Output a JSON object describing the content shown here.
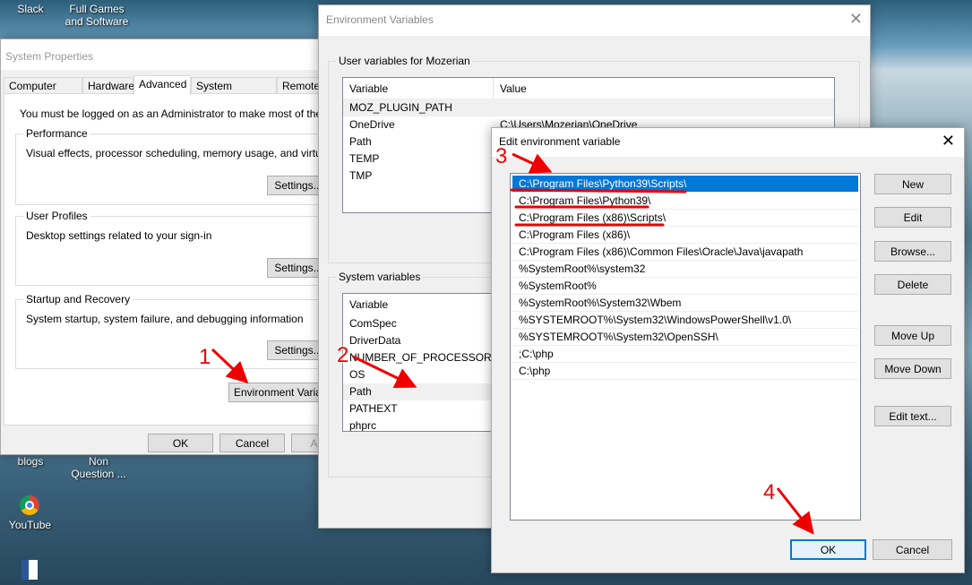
{
  "desktop": {
    "icons": [
      "Slack",
      "Full Games\nand Software",
      "blogs",
      "Non\nQuestion ...",
      "YouTube"
    ]
  },
  "sysprops": {
    "title": "System Properties",
    "tabs": [
      "Computer Name",
      "Hardware",
      "Advanced",
      "System Protection",
      "Remote"
    ],
    "active_tab": "Advanced",
    "admin_note": "You must be logged on as an Administrator to make most of these chan",
    "performance": {
      "label": "Performance",
      "desc": "Visual effects, processor scheduling, memory usage, and virtual memo",
      "button": "Settings..."
    },
    "profiles": {
      "label": "User Profiles",
      "desc": "Desktop settings related to your sign-in",
      "button": "Settings..."
    },
    "startup": {
      "label": "Startup and Recovery",
      "desc": "System startup, system failure, and debugging information",
      "button": "Settings..."
    },
    "env_button": "Environment Variables...",
    "ok": "OK",
    "cancel": "Cancel",
    "apply": "Apply"
  },
  "envvars": {
    "title": "Environment Variables",
    "user_group": "User variables for Mozerian",
    "col_variable": "Variable",
    "col_value": "Value",
    "user_rows": [
      {
        "name": "MOZ_PLUGIN_PATH",
        "value": ""
      },
      {
        "name": "OneDrive",
        "value": "C:\\Users\\Mozerian\\OneDrive"
      },
      {
        "name": "Path",
        "value": ""
      },
      {
        "name": "TEMP",
        "value": ""
      },
      {
        "name": "TMP",
        "value": ""
      }
    ],
    "system_group": "System variables",
    "system_rows": [
      "ComSpec",
      "DriverData",
      "NUMBER_OF_PROCESSORS",
      "OS",
      "Path",
      "PATHEXT",
      "phprc"
    ]
  },
  "editvar": {
    "title": "Edit environment variable",
    "entries": [
      "C:\\Program Files\\Python39\\Scripts\\",
      "C:\\Program Files\\Python39\\",
      "C:\\Program Files (x86)\\Scripts\\",
      "C:\\Program Files (x86)\\",
      "C:\\Program Files (x86)\\Common Files\\Oracle\\Java\\javapath",
      "%SystemRoot%\\system32",
      "%SystemRoot%",
      "%SystemRoot%\\System32\\Wbem",
      "%SYSTEMROOT%\\System32\\WindowsPowerShell\\v1.0\\",
      "%SYSTEMROOT%\\System32\\OpenSSH\\",
      ";C:\\php",
      "C:\\php"
    ],
    "selected_index": 0,
    "buttons": {
      "new": "New",
      "edit": "Edit",
      "browse": "Browse...",
      "delete": "Delete",
      "move_up": "Move Up",
      "move_down": "Move Down",
      "edit_text": "Edit text..."
    },
    "ok": "OK",
    "cancel": "Cancel"
  },
  "annotations": {
    "step1": "1",
    "step2": "2",
    "step3": "3",
    "step4": "4",
    "color": "#e00000"
  },
  "colors": {
    "selection": "#0078d7",
    "accent_border": "#0078d7"
  }
}
